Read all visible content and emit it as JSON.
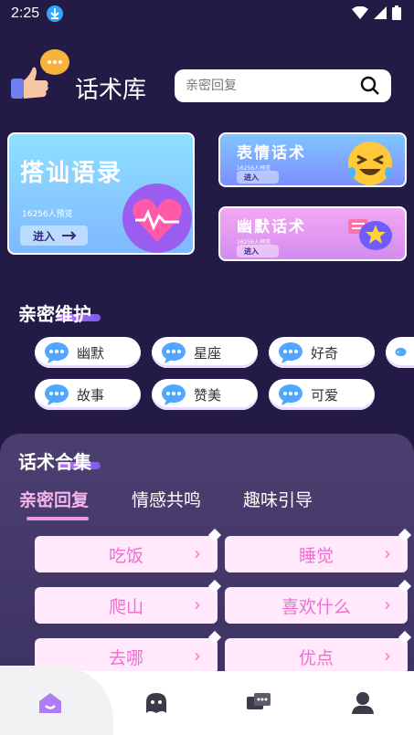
{
  "status_bar": {
    "time": "2:25"
  },
  "header": {
    "title": "话术库"
  },
  "search": {
    "placeholder": "亲密回复"
  },
  "cards": {
    "big": {
      "title": "搭讪语录",
      "count": "16256人预览",
      "enter": "进入"
    },
    "small1": {
      "title": "表情话术",
      "count": "16256人预览",
      "enter": "进入"
    },
    "small2": {
      "title": "幽默话术",
      "count": "16256人预览",
      "enter": "进入"
    }
  },
  "section1": {
    "title": "亲密维护"
  },
  "tags": [
    "幽默",
    "星座",
    "好奇",
    "故事",
    "赞美",
    "可爱"
  ],
  "section2": {
    "title": "话术合集"
  },
  "tabs": [
    "亲密回复",
    "情感共鸣",
    "趣味引导"
  ],
  "phrases": [
    "吃饭",
    "睡觉",
    "爬山",
    "喜欢什么",
    "去哪",
    "优点"
  ],
  "colors": {
    "background": "#231a45",
    "accent_pink": "#ee6fd1",
    "tab_active": "#f7b5ec"
  },
  "nav": [
    "home-icon",
    "chat-icon",
    "messages-icon",
    "profile-icon"
  ]
}
